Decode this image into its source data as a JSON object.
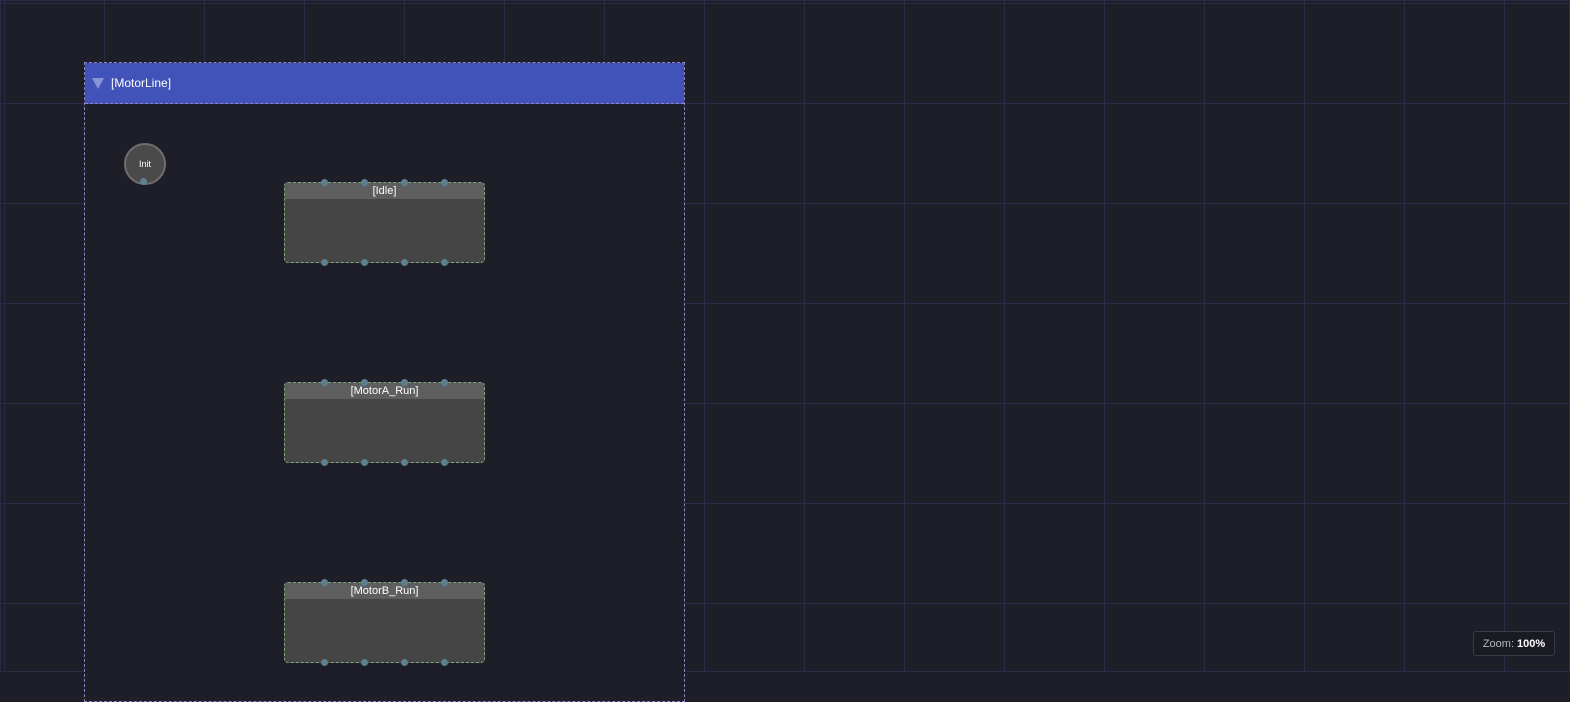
{
  "group": {
    "title": "[MotorLine]",
    "header_color": "#4152b9",
    "border_color": "#8d85c4"
  },
  "init_node": {
    "label": "Init"
  },
  "states": [
    {
      "label": "[Idle]"
    },
    {
      "label": "[MotorA_Run]"
    },
    {
      "label": "[MotorB_Run]"
    }
  ],
  "zoom": {
    "label": "Zoom:",
    "value": "100%"
  },
  "colors": {
    "background": "#1e1e29",
    "grid": "#2b2b48",
    "state_border": "#7da67a",
    "port": "#5e7f90"
  },
  "icons": {
    "collapse": "triangle-down-icon"
  }
}
